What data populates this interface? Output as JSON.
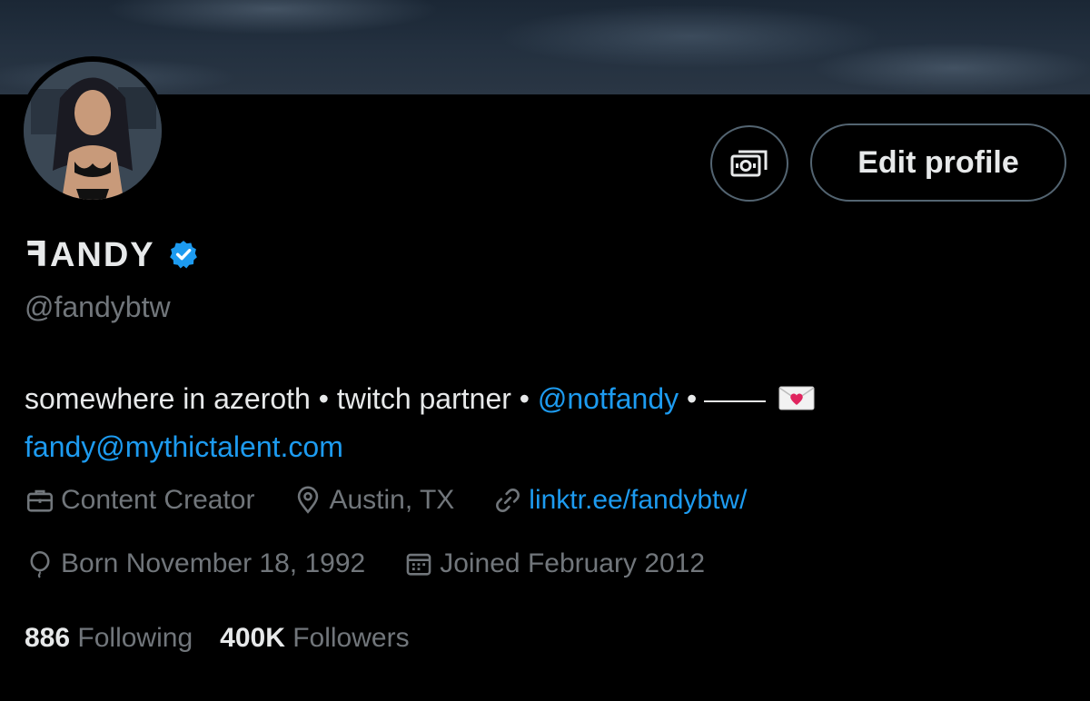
{
  "profile": {
    "name": "ꟻANDY",
    "handle": "@fandybtw",
    "bio_text": "somewhere in azeroth • twitch partner • ",
    "bio_mention": "@notfandy",
    "bio_separator": " •",
    "bio_email": "fandy@mythictalent.com",
    "verified_color": "#1d9bf0"
  },
  "buttons": {
    "edit_profile": "Edit profile",
    "monetization_icon": "money-icon"
  },
  "meta": {
    "category": "Content Creator",
    "location": "Austin, TX",
    "website": "linktr.ee/fandybtw/",
    "born": "Born November 18, 1992",
    "joined": "Joined February 2012"
  },
  "stats": {
    "following_count": "886",
    "following_label": "Following",
    "followers_count": "400K",
    "followers_label": "Followers"
  },
  "colors": {
    "background": "#000000",
    "text_primary": "#e7e9ea",
    "text_secondary": "#71767b",
    "accent": "#1d9bf0",
    "border": "#536471"
  }
}
